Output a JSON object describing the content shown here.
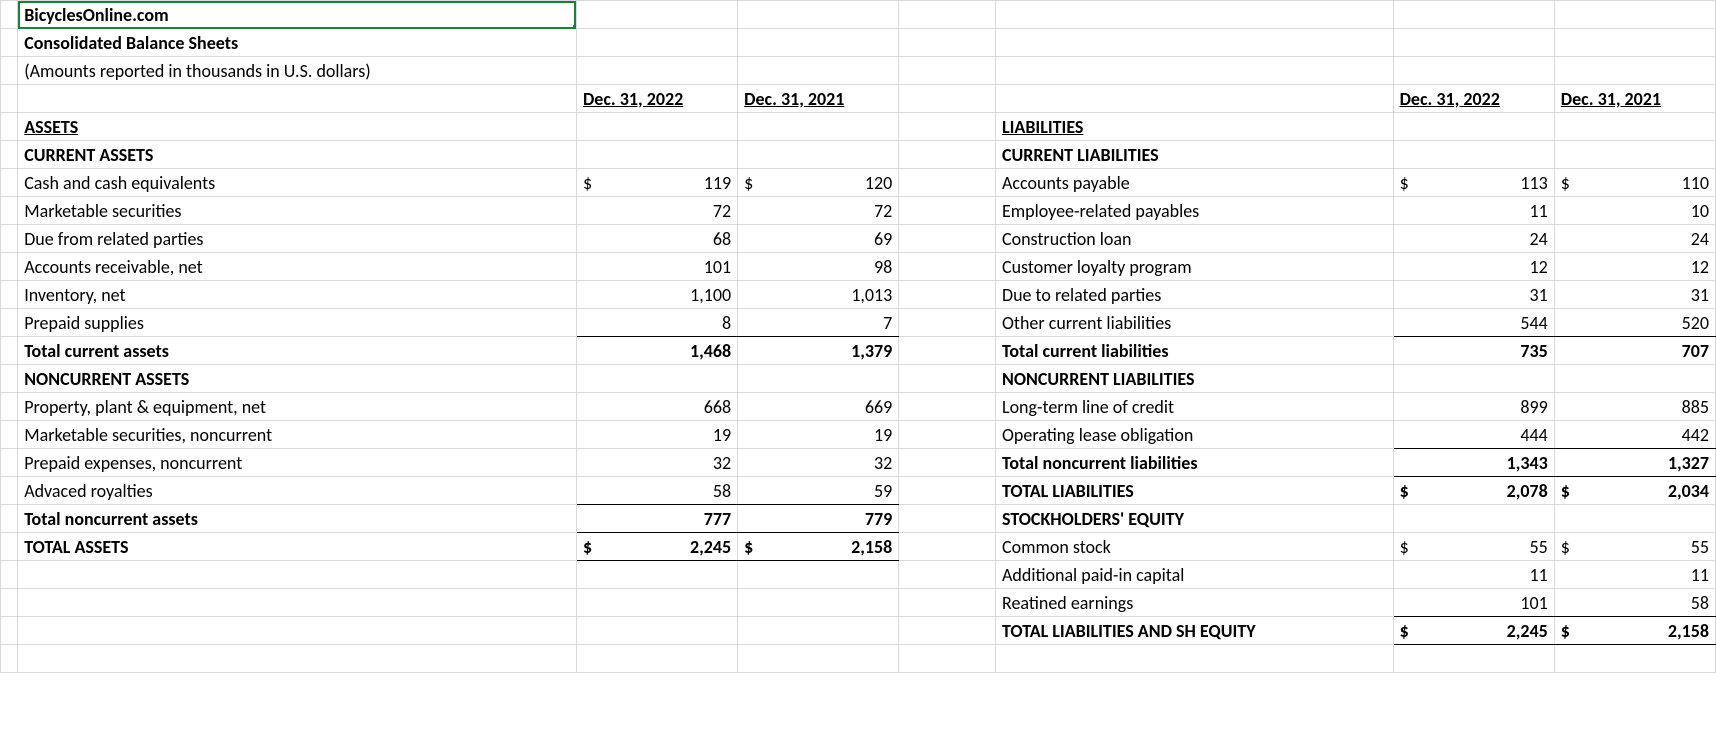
{
  "header": {
    "company": "BicyclesOnline.com",
    "title": "Consolidated Balance Sheets",
    "units": "(Amounts reported in thousands in U.S. dollars)"
  },
  "dates": {
    "d1": "Dec. 31, 2022",
    "d2": "Dec. 31, 2021"
  },
  "assets": {
    "section": "ASSETS",
    "current_hdr": "CURRENT ASSETS",
    "rows": [
      {
        "label": "Cash and cash equivalents",
        "a": "119",
        "b": "120",
        "cur": true
      },
      {
        "label": "Marketable securities",
        "a": "72",
        "b": "72"
      },
      {
        "label": "Due from related parties",
        "a": "68",
        "b": "69"
      },
      {
        "label": "Accounts receivable, net",
        "a": "101",
        "b": "98"
      },
      {
        "label": "Inventory, net",
        "a": "1,100",
        "b": "1,013"
      },
      {
        "label": "Prepaid supplies",
        "a": "8",
        "b": "7",
        "under": true
      }
    ],
    "total_current": {
      "label": "Total current assets",
      "a": "1,468",
      "b": "1,379"
    },
    "noncurrent_hdr": "NONCURRENT ASSETS",
    "ncrows": [
      {
        "label": "Property, plant & equipment, net",
        "a": "668",
        "b": "669"
      },
      {
        "label": "Marketable securities, noncurrent",
        "a": "19",
        "b": "19"
      },
      {
        "label": "Prepaid expenses, noncurrent",
        "a": "32",
        "b": "32"
      },
      {
        "label": "Advaced royalties",
        "a": "58",
        "b": "59",
        "under": true
      }
    ],
    "total_noncurrent": {
      "label": "Total noncurrent assets",
      "a": "777",
      "b": "779"
    },
    "total": {
      "label": "TOTAL ASSETS",
      "a": "2,245",
      "b": "2,158"
    }
  },
  "liab": {
    "section": "LIABILITIES",
    "current_hdr": "CURRENT LIABILITIES",
    "rows": [
      {
        "label": "Accounts payable",
        "a": "113",
        "b": "110",
        "cur": true
      },
      {
        "label": "Employee-related payables",
        "a": "11",
        "b": "10"
      },
      {
        "label": "Construction loan",
        "a": "24",
        "b": "24"
      },
      {
        "label": "Customer loyalty program",
        "a": "12",
        "b": "12"
      },
      {
        "label": "Due to related parties",
        "a": "31",
        "b": "31"
      },
      {
        "label": "Other current liabilities",
        "a": "544",
        "b": "520",
        "under": true
      }
    ],
    "total_current": {
      "label": "Total current liabilities",
      "a": "735",
      "b": "707"
    },
    "noncurrent_hdr": "NONCURRENT LIABILITIES",
    "ncrows": [
      {
        "label": "Long-term line of credit",
        "a": "899",
        "b": "885"
      },
      {
        "label": "Operating lease obligation",
        "a": "444",
        "b": "442",
        "under": true
      }
    ],
    "total_noncurrent": {
      "label": "Total noncurrent liabilities",
      "a": "1,343",
      "b": "1,327"
    },
    "total_liab": {
      "label": "TOTAL LIABILITIES",
      "a": "2,078",
      "b": "2,034"
    },
    "equity_hdr": "STOCKHOLDERS' EQUITY",
    "eqrows": [
      {
        "label": "Common stock",
        "a": "55",
        "b": "55",
        "cur": true
      },
      {
        "label": "Additional paid-in capital",
        "a": "11",
        "b": "11"
      },
      {
        "label": "Reatined earnings",
        "a": "101",
        "b": "58",
        "under": true
      }
    ],
    "grand": {
      "label": "TOTAL LIABILITIES AND SH EQUITY",
      "a": "2,245",
      "b": "2,158"
    }
  },
  "sym": {
    "dollar": "$"
  }
}
